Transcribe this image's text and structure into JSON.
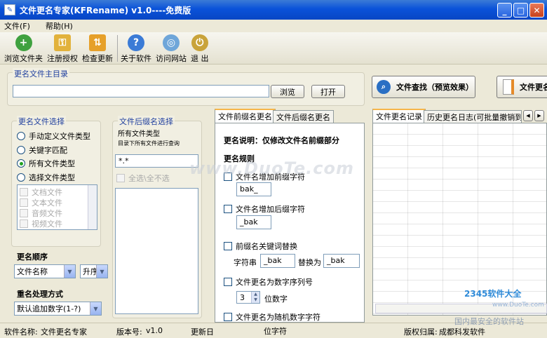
{
  "window": {
    "title": "文件更名专家(KFRename) v1.0----免费版"
  },
  "menu": [
    "文件(F)",
    "帮助(H)"
  ],
  "toolbar": {
    "browse": "浏览文件夹",
    "register": "注册授权",
    "update": "检查更新",
    "about": "关于软件",
    "visit": "访问网站",
    "exit": "退 出"
  },
  "main_dir": {
    "title": "更名文件主目录",
    "value": "",
    "browse_btn": "浏览",
    "open_btn": "打开"
  },
  "big_buttons": {
    "search": "文件查找（预览效果）",
    "rename": "文件更名"
  },
  "file_select": {
    "title": "更名文件选择",
    "options": [
      "手动定义文件类型",
      "关键字匹配",
      "所有文件类型",
      "选择文件类型"
    ],
    "selected_index": 2,
    "types": [
      "文档文件",
      "文本文件",
      "音频文件",
      "视频文件"
    ]
  },
  "suffix_select": {
    "title": "文件后缀名选择",
    "desc1": "所有文件类型",
    "desc2": "目录下所有文件进行查询",
    "value": "*.*",
    "select_all": "全选\\全不选"
  },
  "order": {
    "title": "更名顺序",
    "field": "文件名称",
    "direction": "升序"
  },
  "dup": {
    "title": "重名处理方式",
    "value": "默认追加数字(1-?)"
  },
  "tabs": {
    "prefix": "文件前缀名更名",
    "suffix": "文件后缀名更名"
  },
  "prefix_panel": {
    "desc": "更名说明：仅修改文件名前缀部分",
    "rules_title": "更名规则",
    "add_prefix": "文件名增加前缀字符",
    "prefix_value": "bak_",
    "add_suffix": "文件名增加后缀字符",
    "suffix_value": "_bak",
    "replace": "前缀名关键词替换",
    "str_label": "字符串",
    "str_value": "_bak",
    "replace_with": "替换为",
    "replace_value": "_bak",
    "seq": "文件更名为数字序列号",
    "seq_digits": "3",
    "digits_label": "位数字",
    "random": "文件更名为随机数字字符",
    "random_digits": "6",
    "chars_label": "位字符"
  },
  "log_tabs": {
    "log": "文件更名记录",
    "history": "历史更名日志(可批量撤销到"
  },
  "status": {
    "name_label": "软件名称:",
    "name": "文件更名专家",
    "version_label": "版本号:",
    "version": "v1.0",
    "update_label": "更新日",
    "copyright_label": "版权归属:",
    "copyright": "成都科发软件"
  },
  "watermarks": {
    "center": "www.DuoTe.com",
    "logo": "2345软件大全",
    "logo_url": "www.DuoTe.com",
    "bottom": "国内最安全的软件站"
  }
}
